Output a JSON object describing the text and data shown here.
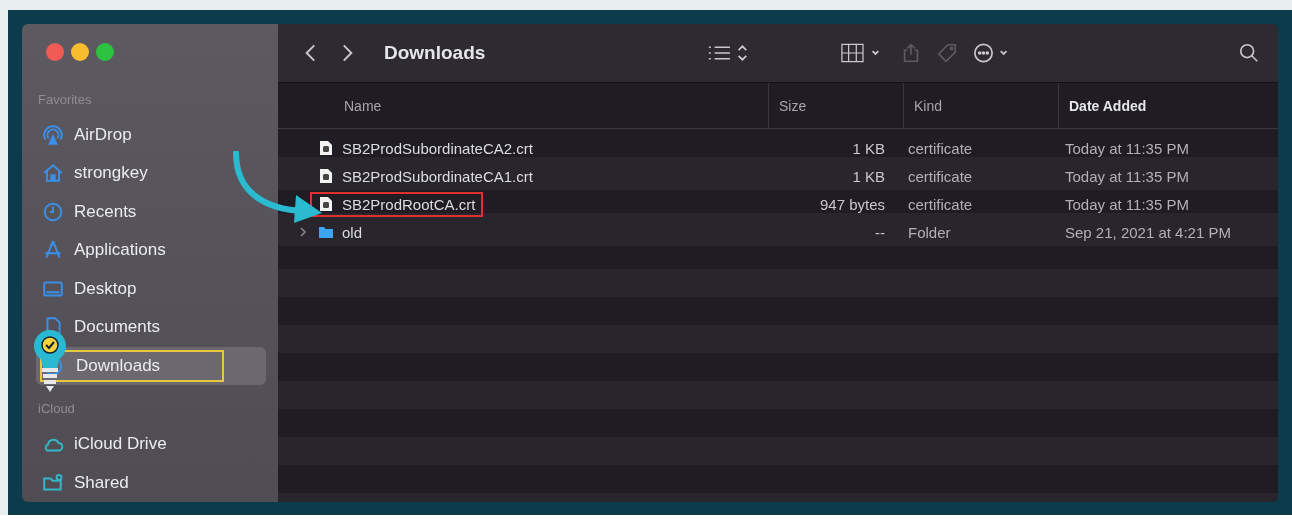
{
  "window": {
    "title": "Downloads"
  },
  "toolbar": {
    "buttons": [
      {
        "kind": "back",
        "disabled": false
      },
      {
        "kind": "forward",
        "disabled": false
      },
      {
        "kind": "list-view",
        "disabled": false
      },
      {
        "kind": "group",
        "disabled": false
      },
      {
        "kind": "share",
        "disabled": true
      },
      {
        "kind": "tag",
        "disabled": true
      },
      {
        "kind": "more",
        "disabled": false
      },
      {
        "kind": "search",
        "disabled": false
      }
    ]
  },
  "sidebar": {
    "sections": [
      {
        "title": "Favorites",
        "items": [
          {
            "label": "AirDrop",
            "kind": "airdrop",
            "selected": false,
            "highlighted": false
          },
          {
            "label": "strongkey",
            "kind": "home",
            "selected": false,
            "highlighted": false
          },
          {
            "label": "Recents",
            "kind": "clock",
            "selected": false,
            "highlighted": false
          },
          {
            "label": "Applications",
            "kind": "apps",
            "selected": false,
            "highlighted": false
          },
          {
            "label": "Desktop",
            "kind": "desktop",
            "selected": false,
            "highlighted": false
          },
          {
            "label": "Documents",
            "kind": "document",
            "selected": false,
            "highlighted": false
          },
          {
            "label": "Downloads",
            "kind": "download",
            "selected": true,
            "highlighted": true
          }
        ]
      },
      {
        "title": "iCloud",
        "items": [
          {
            "label": "iCloud Drive",
            "kind": "cloud",
            "selected": false,
            "highlighted": false
          },
          {
            "label": "Shared",
            "kind": "shared",
            "selected": false,
            "highlighted": false
          }
        ]
      }
    ]
  },
  "table": {
    "columns": [
      {
        "label": "Name",
        "sorted": false
      },
      {
        "label": "Size",
        "sorted": false
      },
      {
        "label": "Kind",
        "sorted": false
      },
      {
        "label": "Date Added",
        "sorted": true
      }
    ],
    "rows": [
      {
        "kind": "file",
        "name": "SB2ProdSubordinateCA2.crt",
        "size": "1 KB",
        "type": "certificate",
        "date": "Today at 11:35 PM",
        "highlighted": false
      },
      {
        "kind": "file",
        "name": "SB2ProdSubordinateCA1.crt",
        "size": "1 KB",
        "type": "certificate",
        "date": "Today at 11:35 PM",
        "highlighted": false
      },
      {
        "kind": "file",
        "name": "SB2ProdRootCA.crt",
        "size": "947 bytes",
        "type": "certificate",
        "date": "Today at 11:35 PM",
        "highlighted": true
      },
      {
        "kind": "folder",
        "name": "old",
        "size": "--",
        "type": "Folder",
        "date": "Sep 21, 2021 at 4:21 PM",
        "highlighted": false
      }
    ]
  }
}
